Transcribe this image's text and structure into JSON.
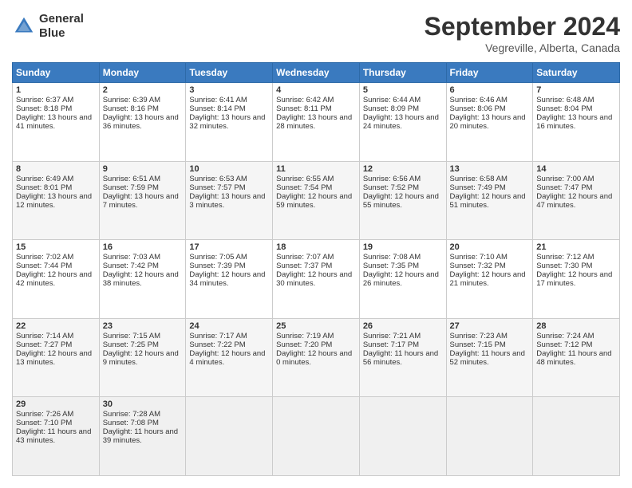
{
  "header": {
    "logo_line1": "General",
    "logo_line2": "Blue",
    "month_title": "September 2024",
    "location": "Vegreville, Alberta, Canada"
  },
  "days_of_week": [
    "Sunday",
    "Monday",
    "Tuesday",
    "Wednesday",
    "Thursday",
    "Friday",
    "Saturday"
  ],
  "weeks": [
    [
      {
        "day": "1",
        "sunrise": "Sunrise: 6:37 AM",
        "sunset": "Sunset: 8:18 PM",
        "daylight": "Daylight: 13 hours and 41 minutes."
      },
      {
        "day": "2",
        "sunrise": "Sunrise: 6:39 AM",
        "sunset": "Sunset: 8:16 PM",
        "daylight": "Daylight: 13 hours and 36 minutes."
      },
      {
        "day": "3",
        "sunrise": "Sunrise: 6:41 AM",
        "sunset": "Sunset: 8:14 PM",
        "daylight": "Daylight: 13 hours and 32 minutes."
      },
      {
        "day": "4",
        "sunrise": "Sunrise: 6:42 AM",
        "sunset": "Sunset: 8:11 PM",
        "daylight": "Daylight: 13 hours and 28 minutes."
      },
      {
        "day": "5",
        "sunrise": "Sunrise: 6:44 AM",
        "sunset": "Sunset: 8:09 PM",
        "daylight": "Daylight: 13 hours and 24 minutes."
      },
      {
        "day": "6",
        "sunrise": "Sunrise: 6:46 AM",
        "sunset": "Sunset: 8:06 PM",
        "daylight": "Daylight: 13 hours and 20 minutes."
      },
      {
        "day": "7",
        "sunrise": "Sunrise: 6:48 AM",
        "sunset": "Sunset: 8:04 PM",
        "daylight": "Daylight: 13 hours and 16 minutes."
      }
    ],
    [
      {
        "day": "8",
        "sunrise": "Sunrise: 6:49 AM",
        "sunset": "Sunset: 8:01 PM",
        "daylight": "Daylight: 13 hours and 12 minutes."
      },
      {
        "day": "9",
        "sunrise": "Sunrise: 6:51 AM",
        "sunset": "Sunset: 7:59 PM",
        "daylight": "Daylight: 13 hours and 7 minutes."
      },
      {
        "day": "10",
        "sunrise": "Sunrise: 6:53 AM",
        "sunset": "Sunset: 7:57 PM",
        "daylight": "Daylight: 13 hours and 3 minutes."
      },
      {
        "day": "11",
        "sunrise": "Sunrise: 6:55 AM",
        "sunset": "Sunset: 7:54 PM",
        "daylight": "Daylight: 12 hours and 59 minutes."
      },
      {
        "day": "12",
        "sunrise": "Sunrise: 6:56 AM",
        "sunset": "Sunset: 7:52 PM",
        "daylight": "Daylight: 12 hours and 55 minutes."
      },
      {
        "day": "13",
        "sunrise": "Sunrise: 6:58 AM",
        "sunset": "Sunset: 7:49 PM",
        "daylight": "Daylight: 12 hours and 51 minutes."
      },
      {
        "day": "14",
        "sunrise": "Sunrise: 7:00 AM",
        "sunset": "Sunset: 7:47 PM",
        "daylight": "Daylight: 12 hours and 47 minutes."
      }
    ],
    [
      {
        "day": "15",
        "sunrise": "Sunrise: 7:02 AM",
        "sunset": "Sunset: 7:44 PM",
        "daylight": "Daylight: 12 hours and 42 minutes."
      },
      {
        "day": "16",
        "sunrise": "Sunrise: 7:03 AM",
        "sunset": "Sunset: 7:42 PM",
        "daylight": "Daylight: 12 hours and 38 minutes."
      },
      {
        "day": "17",
        "sunrise": "Sunrise: 7:05 AM",
        "sunset": "Sunset: 7:39 PM",
        "daylight": "Daylight: 12 hours and 34 minutes."
      },
      {
        "day": "18",
        "sunrise": "Sunrise: 7:07 AM",
        "sunset": "Sunset: 7:37 PM",
        "daylight": "Daylight: 12 hours and 30 minutes."
      },
      {
        "day": "19",
        "sunrise": "Sunrise: 7:08 AM",
        "sunset": "Sunset: 7:35 PM",
        "daylight": "Daylight: 12 hours and 26 minutes."
      },
      {
        "day": "20",
        "sunrise": "Sunrise: 7:10 AM",
        "sunset": "Sunset: 7:32 PM",
        "daylight": "Daylight: 12 hours and 21 minutes."
      },
      {
        "day": "21",
        "sunrise": "Sunrise: 7:12 AM",
        "sunset": "Sunset: 7:30 PM",
        "daylight": "Daylight: 12 hours and 17 minutes."
      }
    ],
    [
      {
        "day": "22",
        "sunrise": "Sunrise: 7:14 AM",
        "sunset": "Sunset: 7:27 PM",
        "daylight": "Daylight: 12 hours and 13 minutes."
      },
      {
        "day": "23",
        "sunrise": "Sunrise: 7:15 AM",
        "sunset": "Sunset: 7:25 PM",
        "daylight": "Daylight: 12 hours and 9 minutes."
      },
      {
        "day": "24",
        "sunrise": "Sunrise: 7:17 AM",
        "sunset": "Sunset: 7:22 PM",
        "daylight": "Daylight: 12 hours and 4 minutes."
      },
      {
        "day": "25",
        "sunrise": "Sunrise: 7:19 AM",
        "sunset": "Sunset: 7:20 PM",
        "daylight": "Daylight: 12 hours and 0 minutes."
      },
      {
        "day": "26",
        "sunrise": "Sunrise: 7:21 AM",
        "sunset": "Sunset: 7:17 PM",
        "daylight": "Daylight: 11 hours and 56 minutes."
      },
      {
        "day": "27",
        "sunrise": "Sunrise: 7:23 AM",
        "sunset": "Sunset: 7:15 PM",
        "daylight": "Daylight: 11 hours and 52 minutes."
      },
      {
        "day": "28",
        "sunrise": "Sunrise: 7:24 AM",
        "sunset": "Sunset: 7:12 PM",
        "daylight": "Daylight: 11 hours and 48 minutes."
      }
    ],
    [
      {
        "day": "29",
        "sunrise": "Sunrise: 7:26 AM",
        "sunset": "Sunset: 7:10 PM",
        "daylight": "Daylight: 11 hours and 43 minutes."
      },
      {
        "day": "30",
        "sunrise": "Sunrise: 7:28 AM",
        "sunset": "Sunset: 7:08 PM",
        "daylight": "Daylight: 11 hours and 39 minutes."
      },
      null,
      null,
      null,
      null,
      null
    ]
  ]
}
